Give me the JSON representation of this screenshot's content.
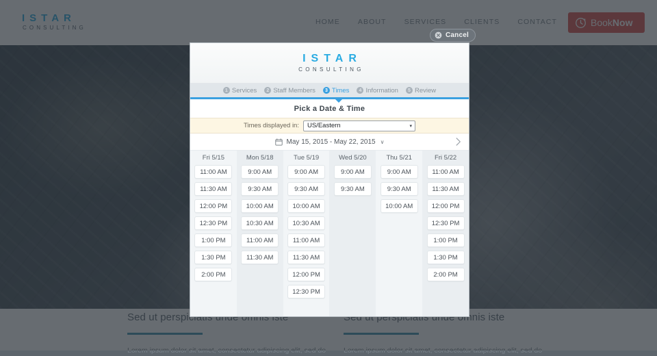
{
  "site": {
    "brand": {
      "name": "ISTAR",
      "tagline": "CONSULTING"
    },
    "nav": [
      {
        "label": "HOME"
      },
      {
        "label": "ABOUT"
      },
      {
        "label": "SERVICES"
      },
      {
        "label": "CLIENTS"
      },
      {
        "label": "CONTACT"
      }
    ],
    "book_button": {
      "word1": "Book",
      "word2": "Now",
      "icon": "clock-arrow-icon"
    },
    "cancel_button": {
      "label": "Cancel",
      "icon": "close-circle-icon"
    },
    "content_columns": [
      {
        "heading": "Sed ut perspiciatis unde omnis iste",
        "body": "Lorem ipsum dolor sit amet, consectetur adipiscing elit, sed do"
      },
      {
        "heading": "Sed ut perspiciatis unde omnis iste",
        "body": "Lorem ipsum dolor sit amet, consectetur adipiscing elit, sed do"
      }
    ]
  },
  "modal": {
    "logo": {
      "name": "ISTAR",
      "tagline": "CONSULTING"
    },
    "steps": [
      {
        "num": "1",
        "label": "Services",
        "active": false
      },
      {
        "num": "2",
        "label": "Staff Members",
        "active": false
      },
      {
        "num": "3",
        "label": "Times",
        "active": true
      },
      {
        "num": "4",
        "label": "Information",
        "active": false
      },
      {
        "num": "5",
        "label": "Review",
        "active": false
      }
    ],
    "title": "Pick a Date & Time",
    "timezone": {
      "label": "Times displayed in:",
      "selected": "US/Eastern",
      "caret": "▾"
    },
    "date_nav": {
      "calendar_icon": "calendar-icon",
      "range": "May 15, 2015 - May 22, 2015",
      "chevron": "∨",
      "next_icon": "chevron-right-icon"
    },
    "days": [
      {
        "header": "Fri 5/15",
        "slots": [
          "11:00 AM",
          "11:30 AM",
          "12:00 PM",
          "12:30 PM",
          "1:00 PM",
          "1:30 PM",
          "2:00 PM"
        ]
      },
      {
        "header": "Mon 5/18",
        "slots": [
          "9:00 AM",
          "9:30 AM",
          "10:00 AM",
          "10:30 AM",
          "11:00 AM",
          "11:30 AM"
        ]
      },
      {
        "header": "Tue 5/19",
        "slots": [
          "9:00 AM",
          "9:30 AM",
          "10:00 AM",
          "10:30 AM",
          "11:00 AM",
          "11:30 AM",
          "12:00 PM",
          "12:30 PM"
        ]
      },
      {
        "header": "Wed 5/20",
        "slots": [
          "9:00 AM",
          "9:30 AM"
        ]
      },
      {
        "header": "Thu 5/21",
        "slots": [
          "9:00 AM",
          "9:30 AM",
          "10:00 AM"
        ]
      },
      {
        "header": "Fri 5/22",
        "slots": [
          "11:00 AM",
          "11:30 AM",
          "12:00 PM",
          "12:30 PM",
          "1:00 PM",
          "1:30 PM",
          "2:00 PM"
        ]
      }
    ]
  },
  "colors": {
    "brand_blue": "#29abe2",
    "step_active": "#3aa0e0",
    "book_red": "#d9534f",
    "rule_blue": "#3f8fb0",
    "overlay": "rgba(38,46,53,0.70)"
  }
}
